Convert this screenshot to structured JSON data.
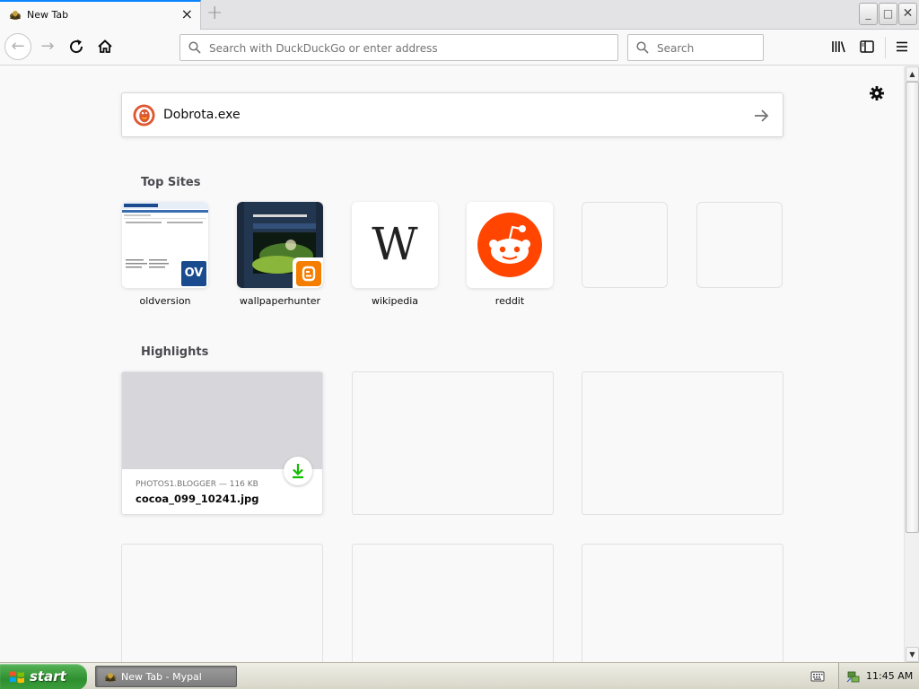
{
  "browser": {
    "tab": {
      "title": "New Tab",
      "favicon": "mypal-icon",
      "close": "×"
    },
    "new_tab_glyph": "+",
    "window_buttons": {
      "minimize": "_",
      "maximize": "□",
      "close": "✕"
    },
    "urlbar": {
      "placeholder": "Search with DuckDuckGo or enter address"
    },
    "searchbar": {
      "placeholder": "Search"
    },
    "nav": {
      "back": "←",
      "forward": "→"
    }
  },
  "newtab": {
    "search": {
      "value": "Dobrota.exe",
      "engine_icon": "duckduckgo-icon"
    },
    "top_sites_title": "Top Sites",
    "top_sites": [
      {
        "label": "oldversion"
      },
      {
        "label": "wallpaperhunter"
      },
      {
        "label": "wikipedia",
        "glyph": "W"
      },
      {
        "label": "reddit"
      },
      {
        "label": ""
      },
      {
        "label": ""
      }
    ],
    "highlights_title": "Highlights",
    "highlights": [
      {
        "meta": "PHOTOS1.BLOGGER — 116 KB",
        "title": "cocoa_099_10241.jpg"
      }
    ],
    "oldversion_badge": "OV"
  },
  "taskbar": {
    "start_label": "start",
    "task_item": "New Tab - Mypal",
    "clock": "11:45 AM"
  },
  "colors": {
    "accent": "#0a84ff",
    "reddit": "#ff4500",
    "blogger": "#f57d00",
    "download_green": "#12bc00",
    "xp_start": "#2e8f2f"
  }
}
